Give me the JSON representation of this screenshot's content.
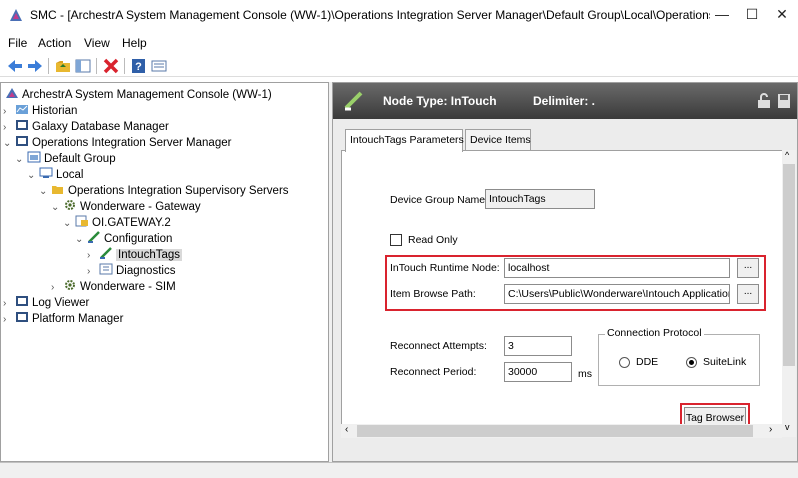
{
  "window": {
    "title": "SMC - [ArchestrA System Management Console (WW-1)\\Operations Integration Server Manager\\Default Group\\Local\\Operations Integrati...",
    "minimize": "—",
    "maximize": "☐",
    "close": "✕"
  },
  "menu": {
    "file": "File",
    "action": "Action",
    "view": "View",
    "help": "Help"
  },
  "toolbar": {
    "back_icon": "arrow-left-icon",
    "forward_icon": "arrow-right-icon"
  },
  "tree": {
    "root": "ArchestrA System Management Console (WW-1)",
    "historian": "Historian",
    "galaxy": "Galaxy Database Manager",
    "ois_manager": "Operations Integration Server Manager",
    "default_group": "Default Group",
    "local": "Local",
    "supervisory": "Operations Integration Supervisory Servers",
    "gateway": "Wonderware - Gateway",
    "oi_gateway": "OI.GATEWAY.2",
    "configuration": "Configuration",
    "intouchtags": "IntouchTags",
    "diagnostics": "Diagnostics",
    "sim": "Wonderware - SIM",
    "log_viewer": "Log Viewer",
    "platform_manager": "Platform Manager"
  },
  "node_header": {
    "node_type": "Node Type: InTouch",
    "delimiter": "Delimiter: ."
  },
  "tabs": {
    "params": "IntouchTags Parameters",
    "device_items": "Device Items"
  },
  "form": {
    "device_group_label": "Device Group Name:",
    "device_group_value": "IntouchTags",
    "read_only_label": "Read Only",
    "runtime_node_label": "InTouch Runtime Node:",
    "runtime_node_value": "localhost",
    "browse_path_label": "Item Browse Path:",
    "browse_path_value": "C:\\Users\\Public\\Wonderware\\Intouch Applications'",
    "ellipsis": "...",
    "reconnect_attempts_label": "Reconnect Attempts:",
    "reconnect_attempts_value": "3",
    "reconnect_period_label": "Reconnect Period:",
    "reconnect_period_value": "30000",
    "ms": "ms",
    "protocol_title": "Connection Protocol",
    "dde": "DDE",
    "suitelink": "SuiteLink",
    "tag_browser": "Tag Browser"
  },
  "colors": {
    "highlight_red": "#d9232e"
  }
}
